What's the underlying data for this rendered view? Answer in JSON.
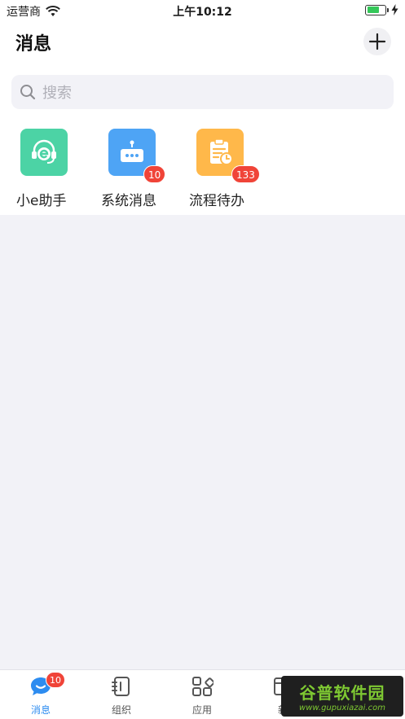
{
  "status_bar": {
    "carrier": "运营商",
    "time": "上午10:12"
  },
  "header": {
    "title": "消息"
  },
  "search": {
    "placeholder": "搜索"
  },
  "entries": [
    {
      "label": "小e助手",
      "icon": "headset-e-icon",
      "color": "#4cd3a5"
    },
    {
      "label": "系统消息",
      "icon": "robot-chat-icon",
      "color": "#4ea4f5",
      "badge": "10"
    },
    {
      "label": "流程待办",
      "icon": "todo-document-icon",
      "color": "#ffb84a",
      "badge": "133"
    }
  ],
  "tab_bar": {
    "tabs": [
      {
        "label": "消息",
        "icon": "chat-bubble-icon",
        "active": true,
        "badge": "10"
      },
      {
        "label": "组织",
        "icon": "contacts-book-icon"
      },
      {
        "label": "应用",
        "icon": "apps-grid-icon"
      },
      {
        "label": "新",
        "icon": "news-icon"
      }
    ],
    "active_color": "#2d8cf0"
  },
  "watermark": {
    "main": "谷普软件园",
    "sub": "www.gupuxiazai.com"
  }
}
